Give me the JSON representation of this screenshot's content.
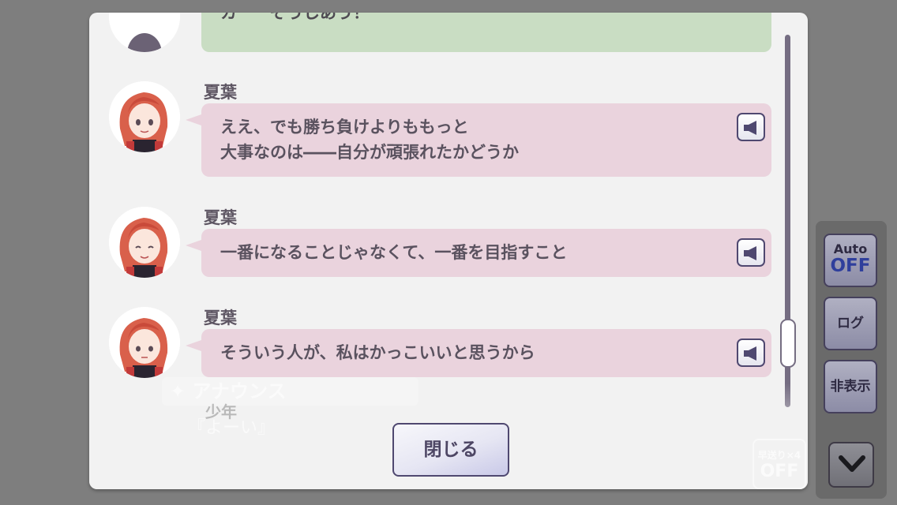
{
  "background": {
    "announce_label": "アナウンス",
    "line1": "少年",
    "line2": "『よーい』",
    "fast_forward_label": "早送り×4",
    "fast_forward_state": "OFF"
  },
  "log": {
    "partial_entry_text": "カ　　ぞうしあう！",
    "entries": [
      {
        "speaker": "夏葉",
        "line1": "ええ、でも勝ち負けよりももっと",
        "line2": "大事なのは――自分が頑張れたかどうか"
      },
      {
        "speaker": "夏葉",
        "line1": "一番になることじゃなくて、一番を目指すこと",
        "line2": ""
      },
      {
        "speaker": "夏葉",
        "line1": "そういう人が、私はかっこいいと思うから",
        "line2": ""
      }
    ],
    "close_label": "閉じる"
  },
  "side_menu": {
    "auto_label": "Auto",
    "auto_state": "OFF",
    "log_label": "ログ",
    "hide_label": "非表示"
  },
  "colors": {
    "bubble_pink": "#ead3dd",
    "bubble_green": "#c9ddc3",
    "accent_purple": "#4f4870",
    "auto_off_blue": "#2f3f9c"
  },
  "icons": [
    "speaker-icon",
    "chevron-down-icon",
    "sparkle-icon"
  ]
}
